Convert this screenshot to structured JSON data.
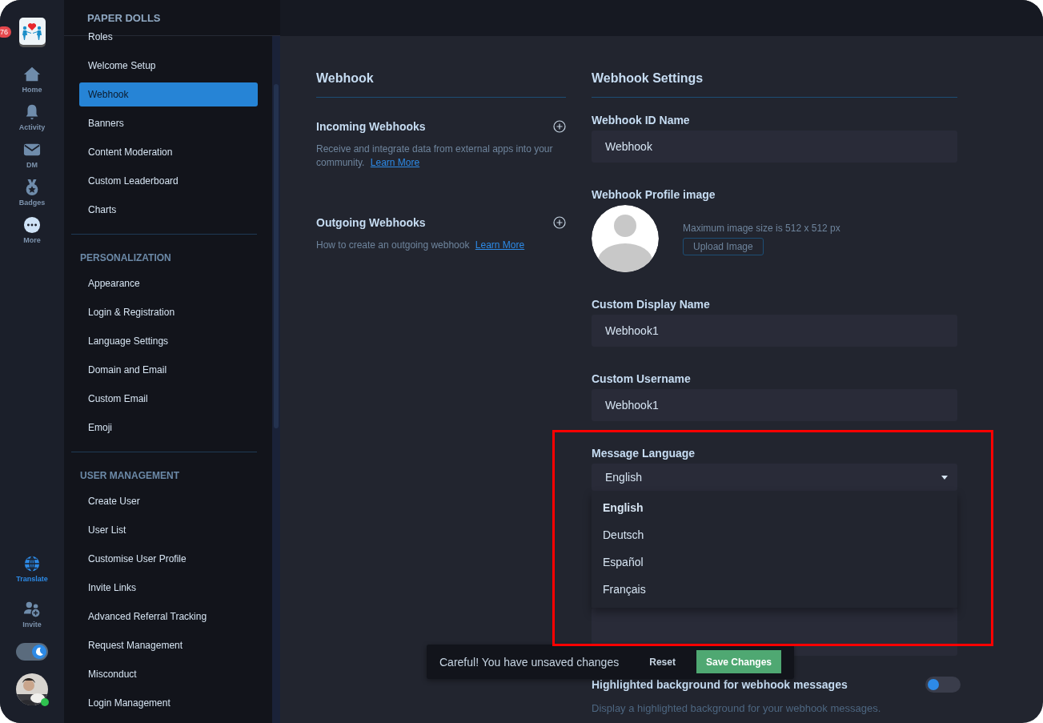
{
  "rail": {
    "badge": "76",
    "top_items": [
      {
        "label": "Home",
        "selected": false
      },
      {
        "label": "Activity",
        "selected": false
      },
      {
        "label": "DM",
        "selected": false
      },
      {
        "label": "Badges",
        "selected": false
      },
      {
        "label": "More",
        "selected": false
      }
    ],
    "bottom_items": [
      {
        "label": "Translate",
        "selected": true
      },
      {
        "label": "Invite",
        "selected": false
      }
    ],
    "dark_mode": true,
    "user_online": true
  },
  "sidebar": {
    "title": "PAPER DOLLS",
    "groups": [
      {
        "items": [
          {
            "label": "Roles",
            "selected": false
          },
          {
            "label": "Welcome Setup",
            "selected": false
          },
          {
            "label": "Webhook",
            "selected": true
          },
          {
            "label": "Banners",
            "selected": false
          },
          {
            "label": "Content Moderation",
            "selected": false
          },
          {
            "label": "Custom Leaderboard",
            "selected": false
          },
          {
            "label": "Charts",
            "selected": false
          }
        ]
      },
      {
        "heading": "PERSONALIZATION",
        "items": [
          {
            "label": "Appearance",
            "selected": false
          },
          {
            "label": "Login & Registration",
            "selected": false
          },
          {
            "label": "Language Settings",
            "selected": false
          },
          {
            "label": "Domain and Email",
            "selected": false
          },
          {
            "label": "Custom Email",
            "selected": false
          },
          {
            "label": "Emoji",
            "selected": false
          }
        ]
      },
      {
        "heading": "USER MANAGEMENT",
        "items": [
          {
            "label": "Create User",
            "selected": false
          },
          {
            "label": "User List",
            "selected": false
          },
          {
            "label": "Customise User Profile",
            "selected": false
          },
          {
            "label": "Invite Links",
            "selected": false
          },
          {
            "label": "Advanced Referral Tracking",
            "selected": false
          },
          {
            "label": "Request Management",
            "selected": false
          },
          {
            "label": "Misconduct",
            "selected": false
          },
          {
            "label": "Login Management",
            "selected": false
          }
        ]
      }
    ]
  },
  "webhook": {
    "title": "Webhook",
    "sections": [
      {
        "title": "Incoming Webhooks",
        "text": "Receive and integrate data from external apps into your community.",
        "link": "Learn More"
      },
      {
        "title": "Outgoing Webhooks",
        "text": "How to create an outgoing webhook",
        "link": "Learn More"
      }
    ]
  },
  "settings": {
    "title": "Webhook Settings",
    "id_name": {
      "label": "Webhook ID Name",
      "value": "Webhook"
    },
    "profile_image": {
      "label": "Webhook Profile image",
      "hint": "Maximum image size is 512 x 512 px",
      "button": "Upload Image"
    },
    "display_name": {
      "label": "Custom Display Name",
      "value": "Webhook1"
    },
    "username": {
      "label": "Custom Username",
      "value": "Webhook1"
    },
    "message_language": {
      "label": "Message Language",
      "value": "English",
      "expanded": true,
      "options": [
        {
          "label": "English",
          "selected": true
        },
        {
          "label": "Deutsch",
          "selected": false
        },
        {
          "label": "Español",
          "selected": false
        },
        {
          "label": "Français",
          "selected": false
        }
      ]
    },
    "highlight": {
      "label": "Highlighted background for webhook messages",
      "description": "Display a highlighted background for your webhook messages.",
      "on": false
    }
  },
  "toast": {
    "text": "Careful! You have unsaved changes",
    "reset": "Reset",
    "save": "Save Changes"
  }
}
